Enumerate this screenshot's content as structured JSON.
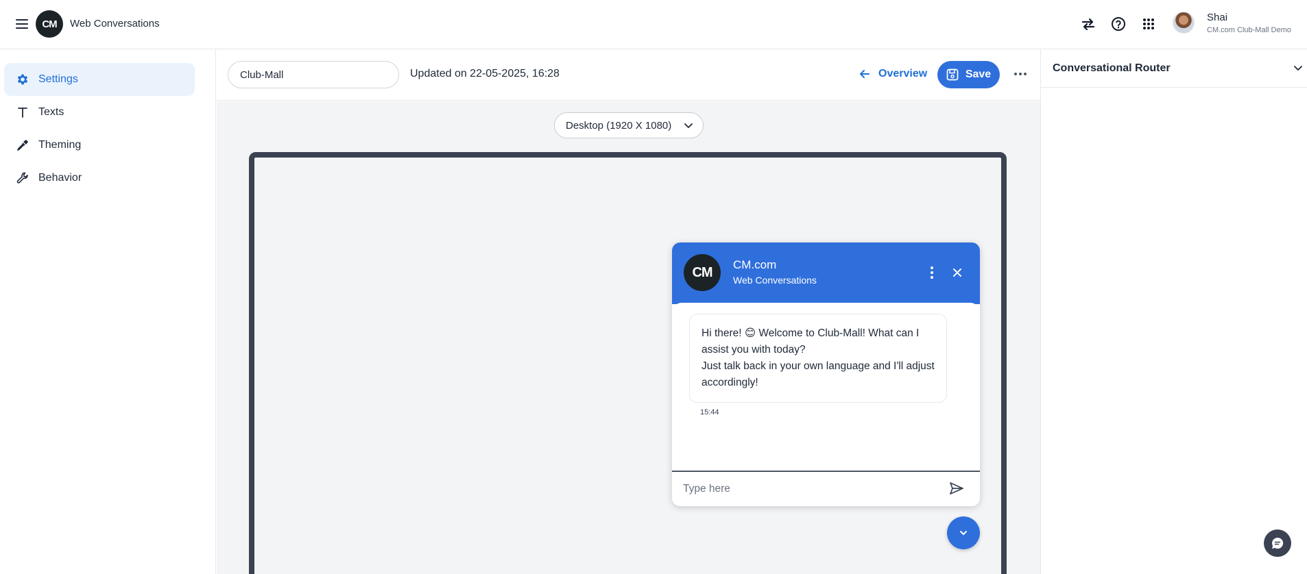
{
  "app": {
    "logo_text": "CM",
    "title": "Web Conversations"
  },
  "topbar": {
    "icons": [
      "swap-arrows-icon",
      "help-icon",
      "apps-grid-icon"
    ],
    "user": {
      "name": "Shai",
      "org": "CM.com Club-Mall Demo"
    }
  },
  "sidebar": {
    "items": [
      {
        "label": "Settings",
        "icon": "gear-icon",
        "active": true
      },
      {
        "label": "Texts",
        "icon": "text-icon",
        "active": false
      },
      {
        "label": "Theming",
        "icon": "eyedropper-icon",
        "active": false
      },
      {
        "label": "Behavior",
        "icon": "wrench-icon",
        "active": false
      }
    ]
  },
  "header": {
    "name_value": "Club-Mall",
    "updated": "Updated on 22-05-2025, 16:28",
    "overview_label": "Overview",
    "save_label": "Save"
  },
  "preview": {
    "device": "Desktop (1920 X 1080)"
  },
  "chat": {
    "logo_text": "CM",
    "title": "CM.com",
    "subtitle": "Web Conversations",
    "message": "Hi there! 😊 Welcome to Club-Mall! What can I assist you with today?\nJust talk back in your own language and I'll adjust accordingly!",
    "time": "15:44",
    "input_placeholder": "Type here"
  },
  "right_panel": {
    "title": "Conversational Router"
  },
  "colors": {
    "accent": "#2f6fdc",
    "active_nav_bg": "#eaf2fc",
    "frame": "#3b4252",
    "logo_bg": "#1c2327"
  }
}
